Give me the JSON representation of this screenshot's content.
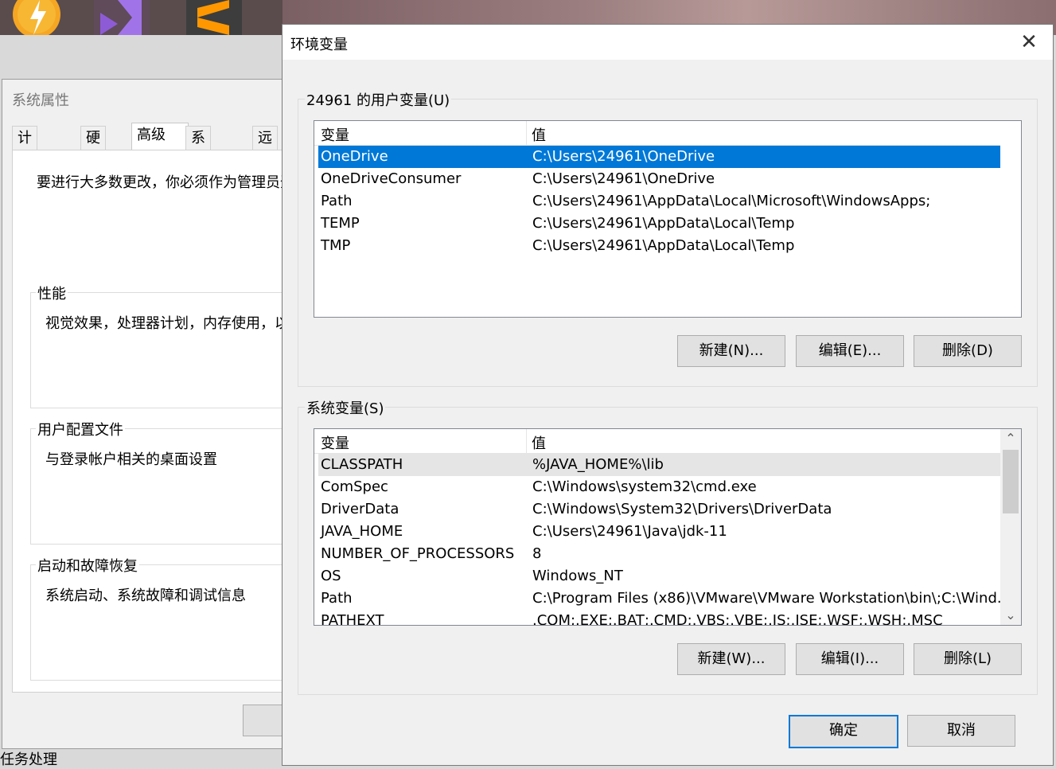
{
  "background_window": {
    "title": "系统属性",
    "tabs": [
      "计算机名",
      "硬件",
      "高级",
      "系统保护",
      "远程"
    ],
    "intro": "要进行大多数更改，你必须作为管理员登",
    "groups": [
      {
        "label": "性能",
        "desc": "视觉效果，处理器计划，内存使用，以"
      },
      {
        "label": "用户配置文件",
        "desc": "与登录帐户相关的桌面设置"
      },
      {
        "label": "启动和故障恢复",
        "desc": "系统启动、系统故障和调试信息"
      }
    ],
    "underneath_text": "任务处理"
  },
  "dialog": {
    "title": "环境变量",
    "close_label": "✕",
    "user_vars": {
      "label": "24961 的用户变量(U)",
      "col_name": "变量",
      "col_value": "值",
      "rows": [
        {
          "name": "OneDrive",
          "value": "C:\\Users\\24961\\OneDrive"
        },
        {
          "name": "OneDriveConsumer",
          "value": "C:\\Users\\24961\\OneDrive"
        },
        {
          "name": "Path",
          "value": "C:\\Users\\24961\\AppData\\Local\\Microsoft\\WindowsApps;"
        },
        {
          "name": "TEMP",
          "value": "C:\\Users\\24961\\AppData\\Local\\Temp"
        },
        {
          "name": "TMP",
          "value": "C:\\Users\\24961\\AppData\\Local\\Temp"
        }
      ],
      "btn_new": "新建(N)...",
      "btn_edit": "编辑(E)...",
      "btn_delete": "删除(D)"
    },
    "sys_vars": {
      "label": "系统变量(S)",
      "col_name": "变量",
      "col_value": "值",
      "rows": [
        {
          "name": "CLASSPATH",
          "value": "%JAVA_HOME%\\lib"
        },
        {
          "name": "ComSpec",
          "value": "C:\\Windows\\system32\\cmd.exe"
        },
        {
          "name": "DriverData",
          "value": "C:\\Windows\\System32\\Drivers\\DriverData"
        },
        {
          "name": "JAVA_HOME",
          "value": "C:\\Users\\24961\\Java\\jdk-11"
        },
        {
          "name": "NUMBER_OF_PROCESSORS",
          "value": "8"
        },
        {
          "name": "OS",
          "value": "Windows_NT"
        },
        {
          "name": "Path",
          "value": "C:\\Program Files (x86)\\VMware\\VMware Workstation\\bin\\;C:\\Wind..."
        },
        {
          "name": "PATHEXT",
          "value": ".COM;.EXE;.BAT;.CMD;.VBS;.VBE;.JS;.JSE;.WSF;.WSH;.MSC"
        }
      ],
      "btn_new": "新建(W)...",
      "btn_edit": "编辑(I)...",
      "btn_delete": "删除(L)"
    },
    "btn_ok": "确定",
    "btn_cancel": "取消"
  }
}
